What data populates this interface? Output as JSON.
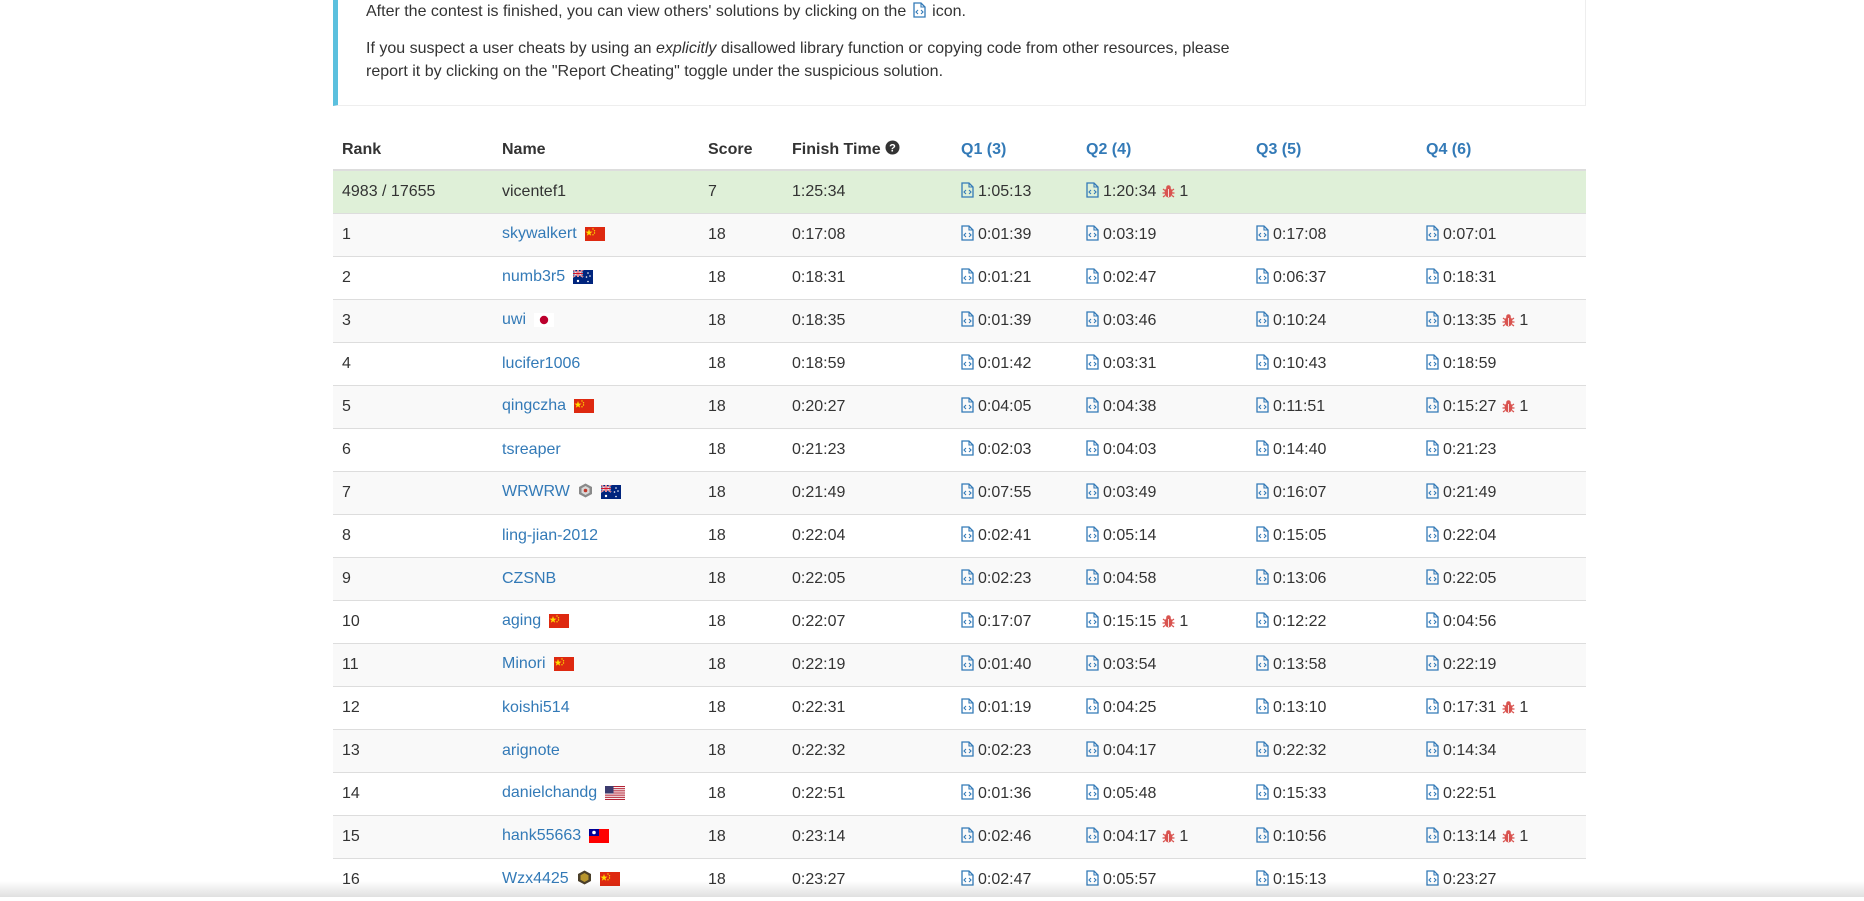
{
  "notice": {
    "line1_before": "After the contest is finished, you can view others' solutions by clicking on the",
    "line1_after": "icon.",
    "line2_before": "If you suspect a user cheats by using an",
    "line2_em": "explicitly",
    "line2_after": "disallowed library function or copying code from other resources, please report it by clicking on the \"Report Cheating\" toggle under the suspicious solution."
  },
  "table": {
    "headers": {
      "rank": "Rank",
      "name": "Name",
      "score": "Score",
      "finish": "Finish Time",
      "q1": "Q1 (3)",
      "q2": "Q2 (4)",
      "q3": "Q3 (5)",
      "q4": "Q4 (6)"
    },
    "me": {
      "rank": "4983 / 17655",
      "name": "vicentef1",
      "score": "7",
      "finish": "1:25:34",
      "q": [
        {
          "time": "1:05:13",
          "bugs": ""
        },
        {
          "time": "1:20:34",
          "bugs": "1"
        },
        null,
        null
      ]
    },
    "rows": [
      {
        "rank": "1",
        "name": "skywalkert",
        "flag": "cn",
        "badge": null,
        "score": "18",
        "finish": "0:17:08",
        "q": [
          {
            "time": "0:01:39",
            "bugs": ""
          },
          {
            "time": "0:03:19",
            "bugs": ""
          },
          {
            "time": "0:17:08",
            "bugs": ""
          },
          {
            "time": "0:07:01",
            "bugs": ""
          }
        ]
      },
      {
        "rank": "2",
        "name": "numb3r5",
        "flag": "au",
        "badge": null,
        "score": "18",
        "finish": "0:18:31",
        "q": [
          {
            "time": "0:01:21",
            "bugs": ""
          },
          {
            "time": "0:02:47",
            "bugs": ""
          },
          {
            "time": "0:06:37",
            "bugs": ""
          },
          {
            "time": "0:18:31",
            "bugs": ""
          }
        ]
      },
      {
        "rank": "3",
        "name": "uwi",
        "flag": "jp",
        "badge": null,
        "score": "18",
        "finish": "0:18:35",
        "q": [
          {
            "time": "0:01:39",
            "bugs": ""
          },
          {
            "time": "0:03:46",
            "bugs": ""
          },
          {
            "time": "0:10:24",
            "bugs": ""
          },
          {
            "time": "0:13:35",
            "bugs": "1"
          }
        ]
      },
      {
        "rank": "4",
        "name": "lucifer1006",
        "flag": null,
        "badge": null,
        "score": "18",
        "finish": "0:18:59",
        "q": [
          {
            "time": "0:01:42",
            "bugs": ""
          },
          {
            "time": "0:03:31",
            "bugs": ""
          },
          {
            "time": "0:10:43",
            "bugs": ""
          },
          {
            "time": "0:18:59",
            "bugs": ""
          }
        ]
      },
      {
        "rank": "5",
        "name": "qingczha",
        "flag": "cn",
        "badge": null,
        "score": "18",
        "finish": "0:20:27",
        "q": [
          {
            "time": "0:04:05",
            "bugs": ""
          },
          {
            "time": "0:04:38",
            "bugs": ""
          },
          {
            "time": "0:11:51",
            "bugs": ""
          },
          {
            "time": "0:15:27",
            "bugs": "1"
          }
        ]
      },
      {
        "rank": "6",
        "name": "tsreaper",
        "flag": null,
        "badge": null,
        "score": "18",
        "finish": "0:21:23",
        "q": [
          {
            "time": "0:02:03",
            "bugs": ""
          },
          {
            "time": "0:04:03",
            "bugs": ""
          },
          {
            "time": "0:14:40",
            "bugs": ""
          },
          {
            "time": "0:21:23",
            "bugs": ""
          }
        ]
      },
      {
        "rank": "7",
        "name": "WRWRW",
        "flag": "au",
        "badge": "guardian",
        "score": "18",
        "finish": "0:21:49",
        "q": [
          {
            "time": "0:07:55",
            "bugs": ""
          },
          {
            "time": "0:03:49",
            "bugs": ""
          },
          {
            "time": "0:16:07",
            "bugs": ""
          },
          {
            "time": "0:21:49",
            "bugs": ""
          }
        ]
      },
      {
        "rank": "8",
        "name": "ling-jian-2012",
        "flag": null,
        "badge": null,
        "score": "18",
        "finish": "0:22:04",
        "q": [
          {
            "time": "0:02:41",
            "bugs": ""
          },
          {
            "time": "0:05:14",
            "bugs": ""
          },
          {
            "time": "0:15:05",
            "bugs": ""
          },
          {
            "time": "0:22:04",
            "bugs": ""
          }
        ]
      },
      {
        "rank": "9",
        "name": "CZSNB",
        "flag": null,
        "badge": null,
        "score": "18",
        "finish": "0:22:05",
        "q": [
          {
            "time": "0:02:23",
            "bugs": ""
          },
          {
            "time": "0:04:58",
            "bugs": ""
          },
          {
            "time": "0:13:06",
            "bugs": ""
          },
          {
            "time": "0:22:05",
            "bugs": ""
          }
        ]
      },
      {
        "rank": "10",
        "name": "aging",
        "flag": "cn",
        "badge": null,
        "score": "18",
        "finish": "0:22:07",
        "q": [
          {
            "time": "0:17:07",
            "bugs": ""
          },
          {
            "time": "0:15:15",
            "bugs": "1"
          },
          {
            "time": "0:12:22",
            "bugs": ""
          },
          {
            "time": "0:04:56",
            "bugs": ""
          }
        ]
      },
      {
        "rank": "11",
        "name": "Minori",
        "flag": "cn",
        "badge": null,
        "score": "18",
        "finish": "0:22:19",
        "q": [
          {
            "time": "0:01:40",
            "bugs": ""
          },
          {
            "time": "0:03:54",
            "bugs": ""
          },
          {
            "time": "0:13:58",
            "bugs": ""
          },
          {
            "time": "0:22:19",
            "bugs": ""
          }
        ]
      },
      {
        "rank": "12",
        "name": "koishi514",
        "flag": null,
        "badge": null,
        "score": "18",
        "finish": "0:22:31",
        "q": [
          {
            "time": "0:01:19",
            "bugs": ""
          },
          {
            "time": "0:04:25",
            "bugs": ""
          },
          {
            "time": "0:13:10",
            "bugs": ""
          },
          {
            "time": "0:17:31",
            "bugs": "1"
          }
        ]
      },
      {
        "rank": "13",
        "name": "arignote",
        "flag": null,
        "badge": null,
        "score": "18",
        "finish": "0:22:32",
        "q": [
          {
            "time": "0:02:23",
            "bugs": ""
          },
          {
            "time": "0:04:17",
            "bugs": ""
          },
          {
            "time": "0:22:32",
            "bugs": ""
          },
          {
            "time": "0:14:34",
            "bugs": ""
          }
        ]
      },
      {
        "rank": "14",
        "name": "danielchandg",
        "flag": "us",
        "badge": null,
        "score": "18",
        "finish": "0:22:51",
        "q": [
          {
            "time": "0:01:36",
            "bugs": ""
          },
          {
            "time": "0:05:48",
            "bugs": ""
          },
          {
            "time": "0:15:33",
            "bugs": ""
          },
          {
            "time": "0:22:51",
            "bugs": ""
          }
        ]
      },
      {
        "rank": "15",
        "name": "hank55663",
        "flag": "tw",
        "badge": null,
        "score": "18",
        "finish": "0:23:14",
        "q": [
          {
            "time": "0:02:46",
            "bugs": ""
          },
          {
            "time": "0:04:17",
            "bugs": "1"
          },
          {
            "time": "0:10:56",
            "bugs": ""
          },
          {
            "time": "0:13:14",
            "bugs": "1"
          }
        ]
      },
      {
        "rank": "16",
        "name": "Wzx4425",
        "flag": "cn",
        "badge": "knight",
        "score": "18",
        "finish": "0:23:27",
        "q": [
          {
            "time": "0:02:47",
            "bugs": ""
          },
          {
            "time": "0:05:57",
            "bugs": ""
          },
          {
            "time": "0:15:13",
            "bugs": ""
          },
          {
            "time": "0:23:27",
            "bugs": ""
          }
        ]
      }
    ]
  },
  "colors": {
    "link": "#337ab7",
    "me_row": "#dff0d8",
    "notice_border": "#5bc0de",
    "bug": "#d9534f"
  },
  "icons": {
    "solution": "code-file-icon",
    "bug": "bug-icon",
    "help": "question-circle-icon"
  }
}
